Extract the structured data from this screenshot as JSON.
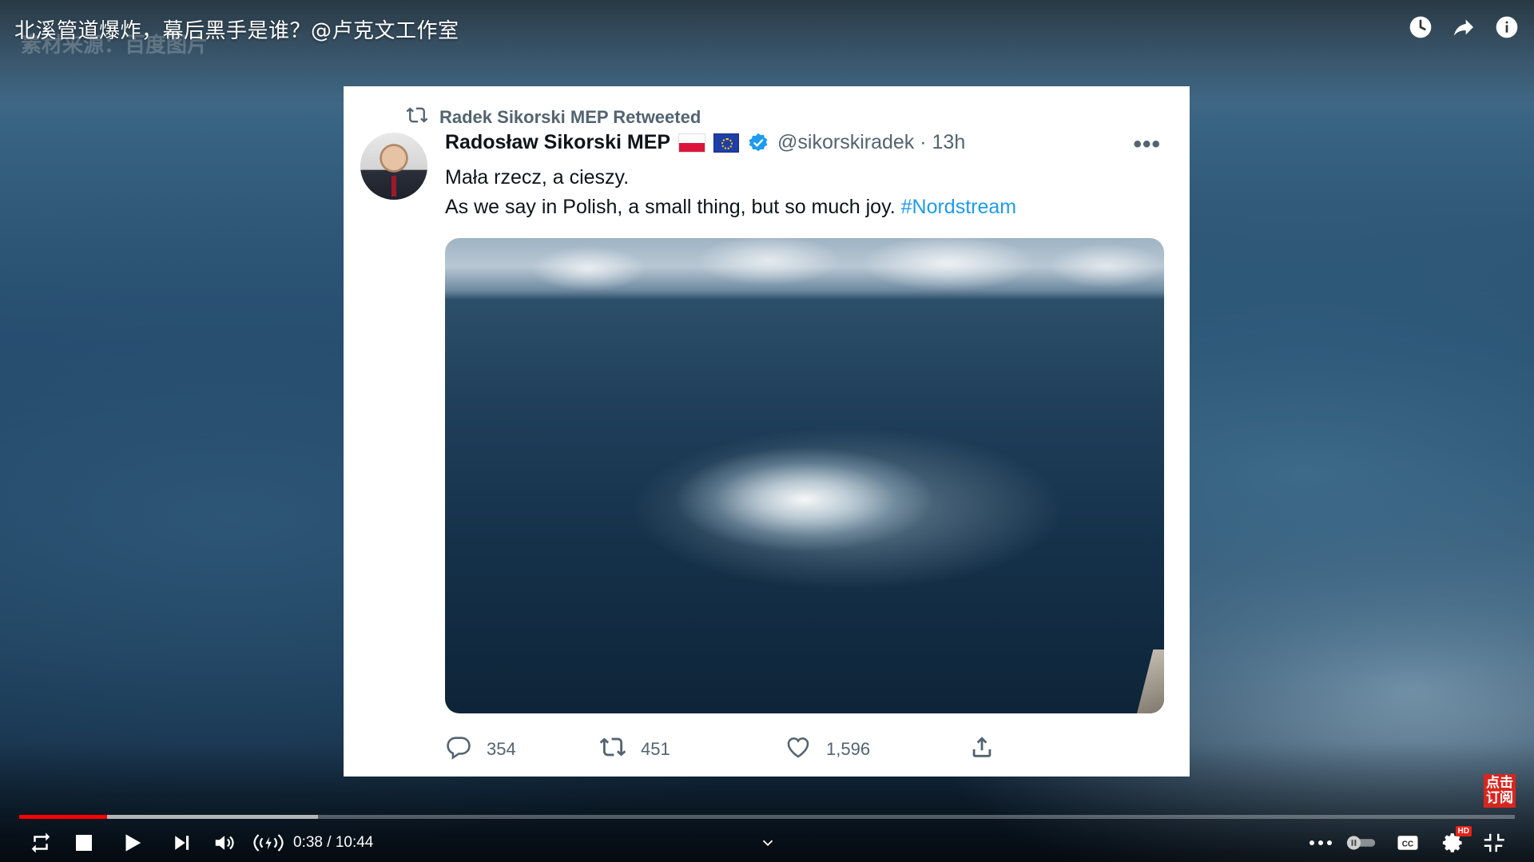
{
  "video": {
    "title": "北溪管道爆炸，幕后黑手是谁？@卢克文工作室",
    "ghost_caption": "素材来源：百度图片",
    "top_icons": [
      "watch-later-icon",
      "share-icon",
      "info-icon"
    ]
  },
  "tweet": {
    "retweeted_by": "Radek Sikorski MEP Retweeted",
    "display_name": "Radosław Sikorski MEP",
    "handle_time": "@sikorskiradek · 13h",
    "line1": "Mała rzecz, a cieszy.",
    "line2": "As we say in Polish, a small thing, but so much joy.",
    "hashtag": "#Nordstream",
    "more": "•••",
    "replies": "354",
    "retweets": "451",
    "likes": "1,596"
  },
  "subscribe_badge": "点击订阅",
  "player": {
    "current_time": "0:38",
    "duration": "10:44",
    "time_display": "0:38 / 10:44",
    "played_fraction": 0.059,
    "buffered_fraction": 0.2
  },
  "colors": {
    "progress_played": "#ff0000",
    "hashtag": "#1d9bf0",
    "verified": "#1d9bf0"
  }
}
